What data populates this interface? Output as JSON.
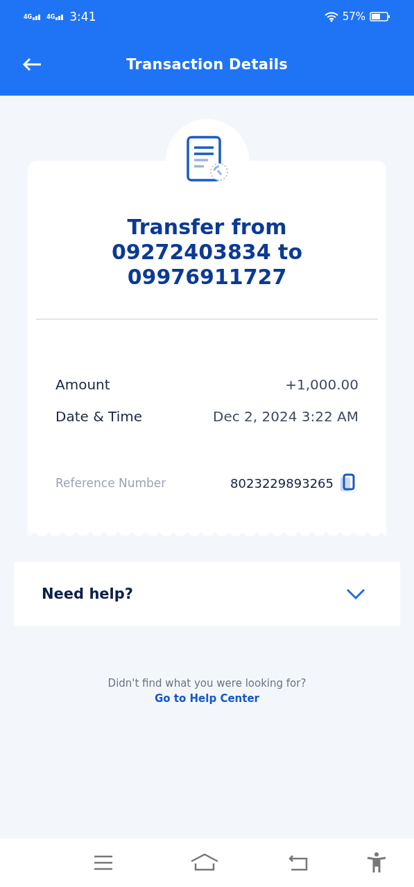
{
  "status_bar": {
    "network_1": "4G",
    "network_2": "4G",
    "time": "3:41",
    "battery": "57%"
  },
  "header": {
    "title": "Transaction Details"
  },
  "receipt": {
    "title": "Transfer from 09272403834 to 09976911727",
    "details": [
      {
        "label": "Amount",
        "value": "+1,000.00"
      },
      {
        "label": "Date & Time",
        "value": "Dec 2, 2024 3:22 AM"
      }
    ],
    "reference": {
      "label": "Reference Number",
      "value": "8023229893265"
    }
  },
  "help": {
    "title": "Need help?",
    "expanded": false
  },
  "footer": {
    "text": "Didn't find what you were looking for?",
    "link": "Go to Help Center"
  }
}
